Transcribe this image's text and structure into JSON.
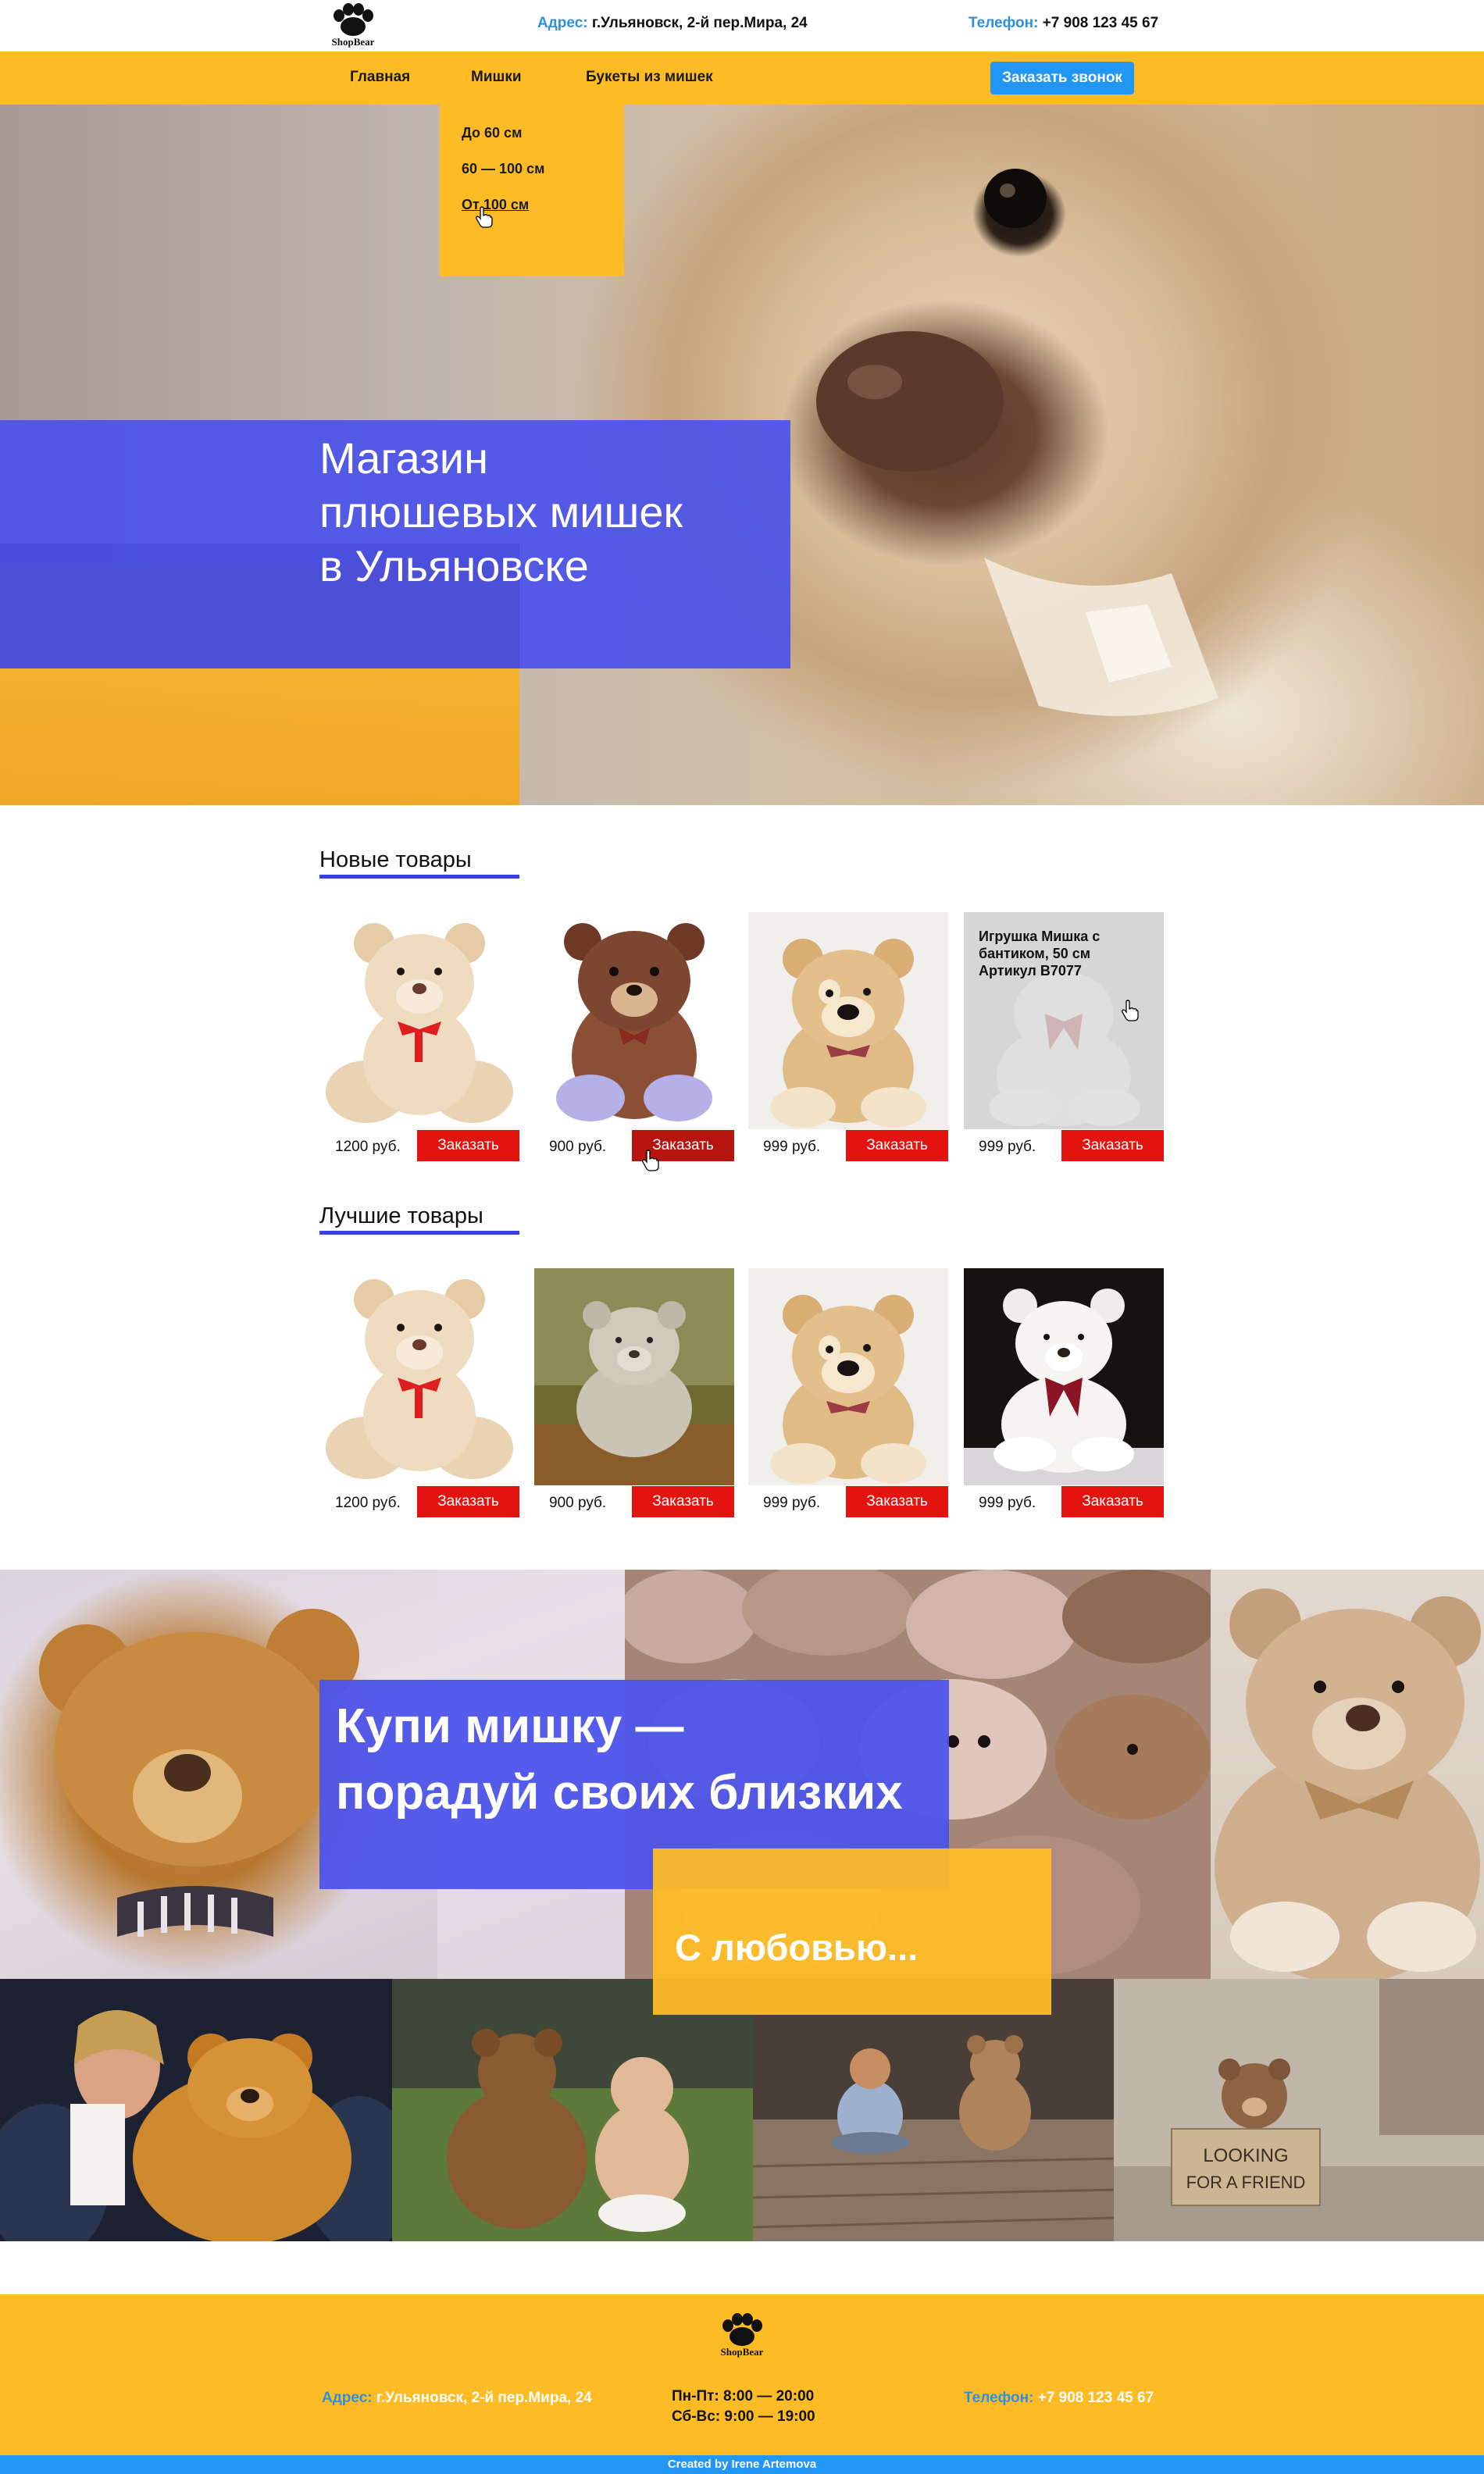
{
  "header": {
    "logo_text": "ShopBear",
    "address_label": "Адрес:",
    "address_value": "г.Ульяновск, 2-й пер.Мира, 24",
    "phone_label": "Телефон:",
    "phone_value": "+7 908 123 45 67"
  },
  "nav": {
    "items": [
      {
        "label": "Главная"
      },
      {
        "label": "Мишки"
      },
      {
        "label": "Букеты из мишек"
      }
    ],
    "call_button": "Заказать звонок",
    "dropdown": [
      {
        "label": "До 60 см"
      },
      {
        "label": "60 — 100 см"
      },
      {
        "label": "От 100 см"
      }
    ]
  },
  "hero": {
    "title_lines": [
      "Магазин",
      "плюшевых мишек",
      "в Ульяновске"
    ]
  },
  "new_products": {
    "title": "Новые товары",
    "items": [
      {
        "price": "1200 руб.",
        "button": "Заказать",
        "image": "cream-bear-red-bow"
      },
      {
        "price": "900 руб.",
        "button": "Заказать",
        "image": "brown-bear-purple-paws"
      },
      {
        "price": "999 руб.",
        "button": "Заказать",
        "image": "beige-bear-patch-eye"
      },
      {
        "price": "999 руб.",
        "button": "Заказать",
        "image": "white-bear-bow",
        "tooltip": [
          "Игрушка Мишка с",
          "бантиком, 50 см",
          "Артикул В7077"
        ]
      }
    ]
  },
  "best_products": {
    "title": "Лучшие товары",
    "items": [
      {
        "price": "1200 руб.",
        "button": "Заказать",
        "image": "cream-bear-red-bow"
      },
      {
        "price": "900 руб.",
        "button": "Заказать",
        "image": "grey-bear-on-moss"
      },
      {
        "price": "999 руб.",
        "button": "Заказать",
        "image": "beige-bear-patch-eye"
      },
      {
        "price": "999 руб.",
        "button": "Заказать",
        "image": "white-bear-dark-bg"
      }
    ]
  },
  "promo": {
    "title_lines": [
      "Купи мишку —",
      "порадуй своих близких"
    ],
    "subtitle": "С любовью...",
    "sign_lines": [
      "LOOKING",
      "FOR A FRIEND"
    ]
  },
  "footer": {
    "logo_text": "ShopBear",
    "address_label": "Адрес:",
    "address_value": "г.Ульяновск, 2-й пер.Мира, 24",
    "hours": [
      "Пн-Пт: 8:00 — 20:00",
      "Сб-Вс: 9:00 — 19:00"
    ],
    "phone_label": "Телефон:",
    "phone_value": "+7 908 123 45 67",
    "credits": "Created by Irene Artemova"
  },
  "colors": {
    "yellow": "#fdbc26",
    "blue_overlay": "#4b53ea",
    "link_blue": "#2f8fe0",
    "button_blue": "#2196f3",
    "order_red": "#e3130f"
  }
}
